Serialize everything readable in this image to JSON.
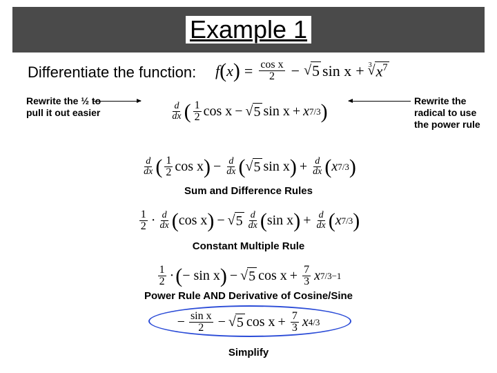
{
  "title": "Example 1",
  "subtitle": "Differentiate the function:",
  "main_eq": {
    "f_open": "f",
    "x_arg": "x",
    "num1": "cos x",
    "den1": "2",
    "sqrt5": "5",
    "sin": "sin x",
    "root_idx": "3",
    "root_arg": "x",
    "root_pow": "7"
  },
  "notes": {
    "left": "Rewrite the ½ to pull it out easier",
    "right": "Rewrite the radical to use the power rule"
  },
  "steps": {
    "eq1_half_num": "1",
    "eq1_half_den": "2",
    "cos": "cos x",
    "sqrt5": "5",
    "sin": "sin x",
    "xpow": "x",
    "pow73": "7/3",
    "d": "d",
    "dx": "dx",
    "label2": "Sum and Difference Rules",
    "label3": "Constant Multiple Rule",
    "eq4_text": "Power Rule AND Derivative of Cosine/Sine",
    "neg_sin": "− sin x",
    "seven_num": "7",
    "three_den": "3",
    "pow731": "7/3−1",
    "pow43": "4/3",
    "label5": "Simplify",
    "final_num": "sin x",
    "final_den": "2"
  }
}
